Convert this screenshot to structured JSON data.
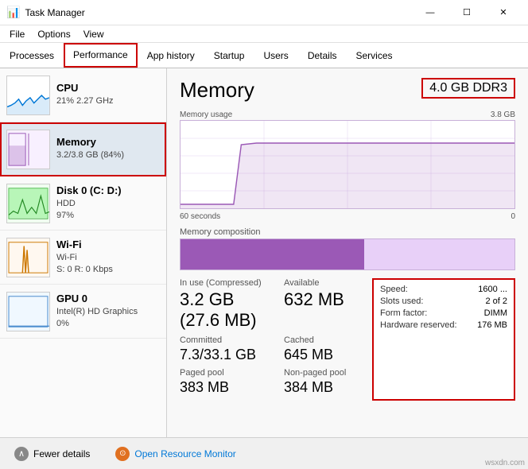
{
  "titleBar": {
    "icon": "📊",
    "title": "Task Manager",
    "minBtn": "—",
    "maxBtn": "☐",
    "closeBtn": "✕"
  },
  "menuBar": {
    "items": [
      "File",
      "Options",
      "View"
    ]
  },
  "tabs": [
    {
      "id": "processes",
      "label": "Processes",
      "active": false
    },
    {
      "id": "performance",
      "label": "Performance",
      "active": true
    },
    {
      "id": "apphistory",
      "label": "App history",
      "active": false
    },
    {
      "id": "startup",
      "label": "Startup",
      "active": false
    },
    {
      "id": "users",
      "label": "Users",
      "active": false
    },
    {
      "id": "details",
      "label": "Details",
      "active": false
    },
    {
      "id": "services",
      "label": "Services",
      "active": false
    }
  ],
  "sidebar": {
    "items": [
      {
        "id": "cpu",
        "name": "CPU",
        "sub1": "21% 2.27 GHz",
        "sub2": "",
        "active": false,
        "type": "cpu"
      },
      {
        "id": "memory",
        "name": "Memory",
        "sub1": "3.2/3.8 GB (84%)",
        "sub2": "",
        "active": true,
        "type": "memory"
      },
      {
        "id": "disk",
        "name": "Disk 0 (C: D:)",
        "sub1": "HDD",
        "sub2": "97%",
        "active": false,
        "type": "disk"
      },
      {
        "id": "wifi",
        "name": "Wi-Fi",
        "sub1": "Wi-Fi",
        "sub2": "S: 0 R: 0 Kbps",
        "active": false,
        "type": "wifi"
      },
      {
        "id": "gpu",
        "name": "GPU 0",
        "sub1": "Intel(R) HD Graphics",
        "sub2": "0%",
        "active": false,
        "type": "gpu"
      }
    ]
  },
  "panel": {
    "title": "Memory",
    "badge": "4.0 GB DDR3",
    "usageLabel": "Memory usage",
    "usageMax": "3.8 GB",
    "timeLabel": "60 seconds",
    "timeEnd": "0",
    "compositionLabel": "Memory composition",
    "stats": {
      "inUseLabel": "In use (Compressed)",
      "inUseValue": "3.2 GB (27.6 MB)",
      "availableLabel": "Available",
      "availableValue": "632 MB",
      "committedLabel": "Committed",
      "committedValue": "7.3/33.1 GB",
      "cachedLabel": "Cached",
      "cachedValue": "645 MB",
      "pagedLabel": "Paged pool",
      "pagedValue": "383 MB",
      "nonPagedLabel": "Non-paged pool",
      "nonPagedValue": "384 MB"
    },
    "info": {
      "speedLabel": "Speed:",
      "speedValue": "1600 ...",
      "slotsLabel": "Slots used:",
      "slotsValue": "2 of 2",
      "formLabel": "Form factor:",
      "formValue": "DIMM",
      "hwResLabel": "Hardware reserved:",
      "hwResValue": "176 MB"
    }
  },
  "bottomBar": {
    "fewerDetailsLabel": "Fewer details",
    "openMonitorLabel": "Open Resource Monitor"
  },
  "watermark": "wsxdn.com"
}
